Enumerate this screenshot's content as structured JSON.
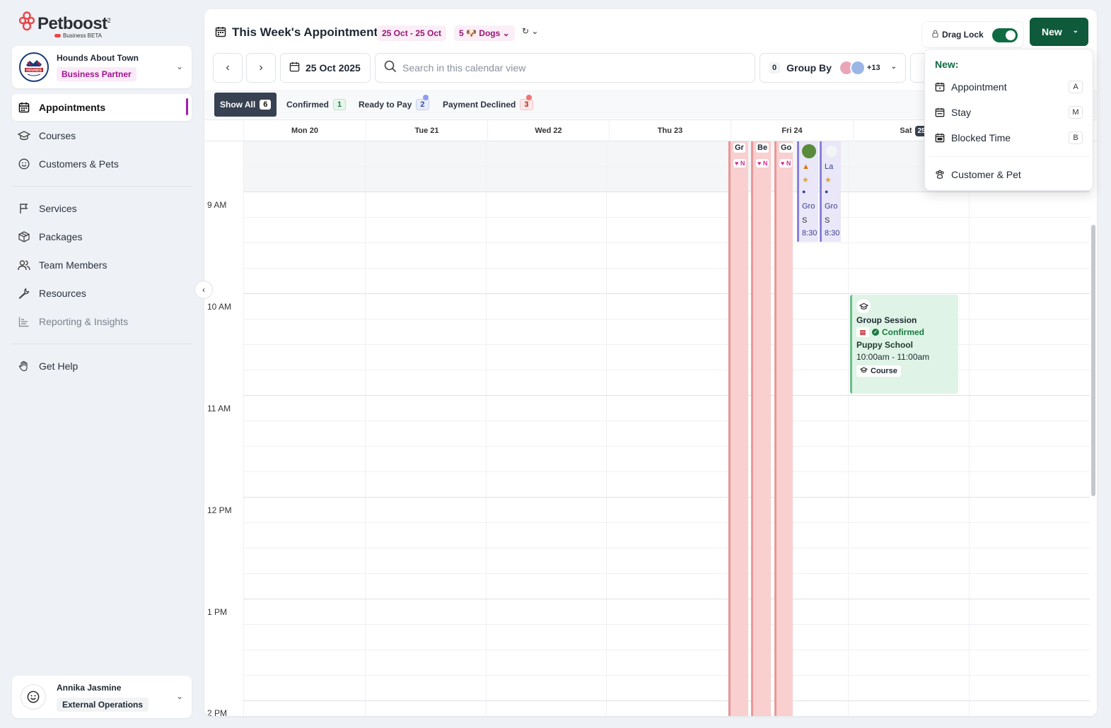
{
  "brand": {
    "name": "Petboost",
    "superscript": "2",
    "sub": "Business BETA"
  },
  "business": {
    "name": "Hounds About Town",
    "badge": "Business Partner",
    "logo_text": "HOUNDS"
  },
  "nav": {
    "primary": [
      {
        "label": "Appointments",
        "icon": "calendar-icon"
      },
      {
        "label": "Courses",
        "icon": "graduation-cap-icon"
      },
      {
        "label": "Customers & Pets",
        "icon": "smiley-icon"
      }
    ],
    "secondary": [
      {
        "label": "Services",
        "icon": "flag-icon"
      },
      {
        "label": "Packages",
        "icon": "package-icon"
      },
      {
        "label": "Team Members",
        "icon": "users-icon"
      },
      {
        "label": "Resources",
        "icon": "wrench-icon"
      },
      {
        "label": "Reporting & Insights",
        "icon": "chart-icon"
      }
    ],
    "help": {
      "label": "Get Help",
      "icon": "hand-icon"
    }
  },
  "user": {
    "name": "Annika Jasmine",
    "role": "External Operations"
  },
  "header": {
    "title": "This Week's Appointments",
    "date_range": "25 Oct - 25 Oct",
    "dogs_filter": "5 🐶 Dogs",
    "drag_lock_label": "Drag Lock",
    "drag_lock_on": true,
    "new_label": "New"
  },
  "toolbar": {
    "date": "25 Oct 2025",
    "search_placeholder": "Search in this calendar view",
    "group_count": "0",
    "group_by_label": "Group By",
    "group_more": "+13"
  },
  "filters": [
    {
      "label": "Show All",
      "count": "6"
    },
    {
      "label": "Confirmed",
      "count": "1"
    },
    {
      "label": "Ready to Pay",
      "count": "2"
    },
    {
      "label": "Payment Declined",
      "count": "3"
    }
  ],
  "days": [
    "Mon 20",
    "Tue 21",
    "Wed 22",
    "Thu 23",
    "Fri 24",
    "Sat",
    "25"
  ],
  "times": [
    "9 AM",
    "10 AM",
    "11 AM",
    "12 PM",
    "1 PM",
    "2 PM"
  ],
  "events": {
    "red_tags": [
      "Gr",
      "Be",
      "Go"
    ],
    "red_heart": "♥ N",
    "purple": [
      {
        "l3": "Gro",
        "l4": "S",
        "l5": "8:30"
      },
      {
        "l1": "La",
        "l3": "Gro",
        "l4": "S",
        "l5": "8:30"
      }
    ],
    "course": {
      "title": "Group Session",
      "status": "Confirmed",
      "name": "Puppy School",
      "time": "10:00am - 11:00am",
      "tag": "Course"
    }
  },
  "new_menu": {
    "heading": "New:",
    "items": [
      {
        "label": "Appointment",
        "key": "A"
      },
      {
        "label": "Stay",
        "key": "M"
      },
      {
        "label": "Blocked Time",
        "key": "B"
      },
      {
        "label": "Customer & Pet"
      }
    ]
  },
  "colors": {
    "accent": "#0f5a3a",
    "brand": "#a21caf",
    "declined": "#f9cfcf",
    "course": "#dff4e6"
  }
}
